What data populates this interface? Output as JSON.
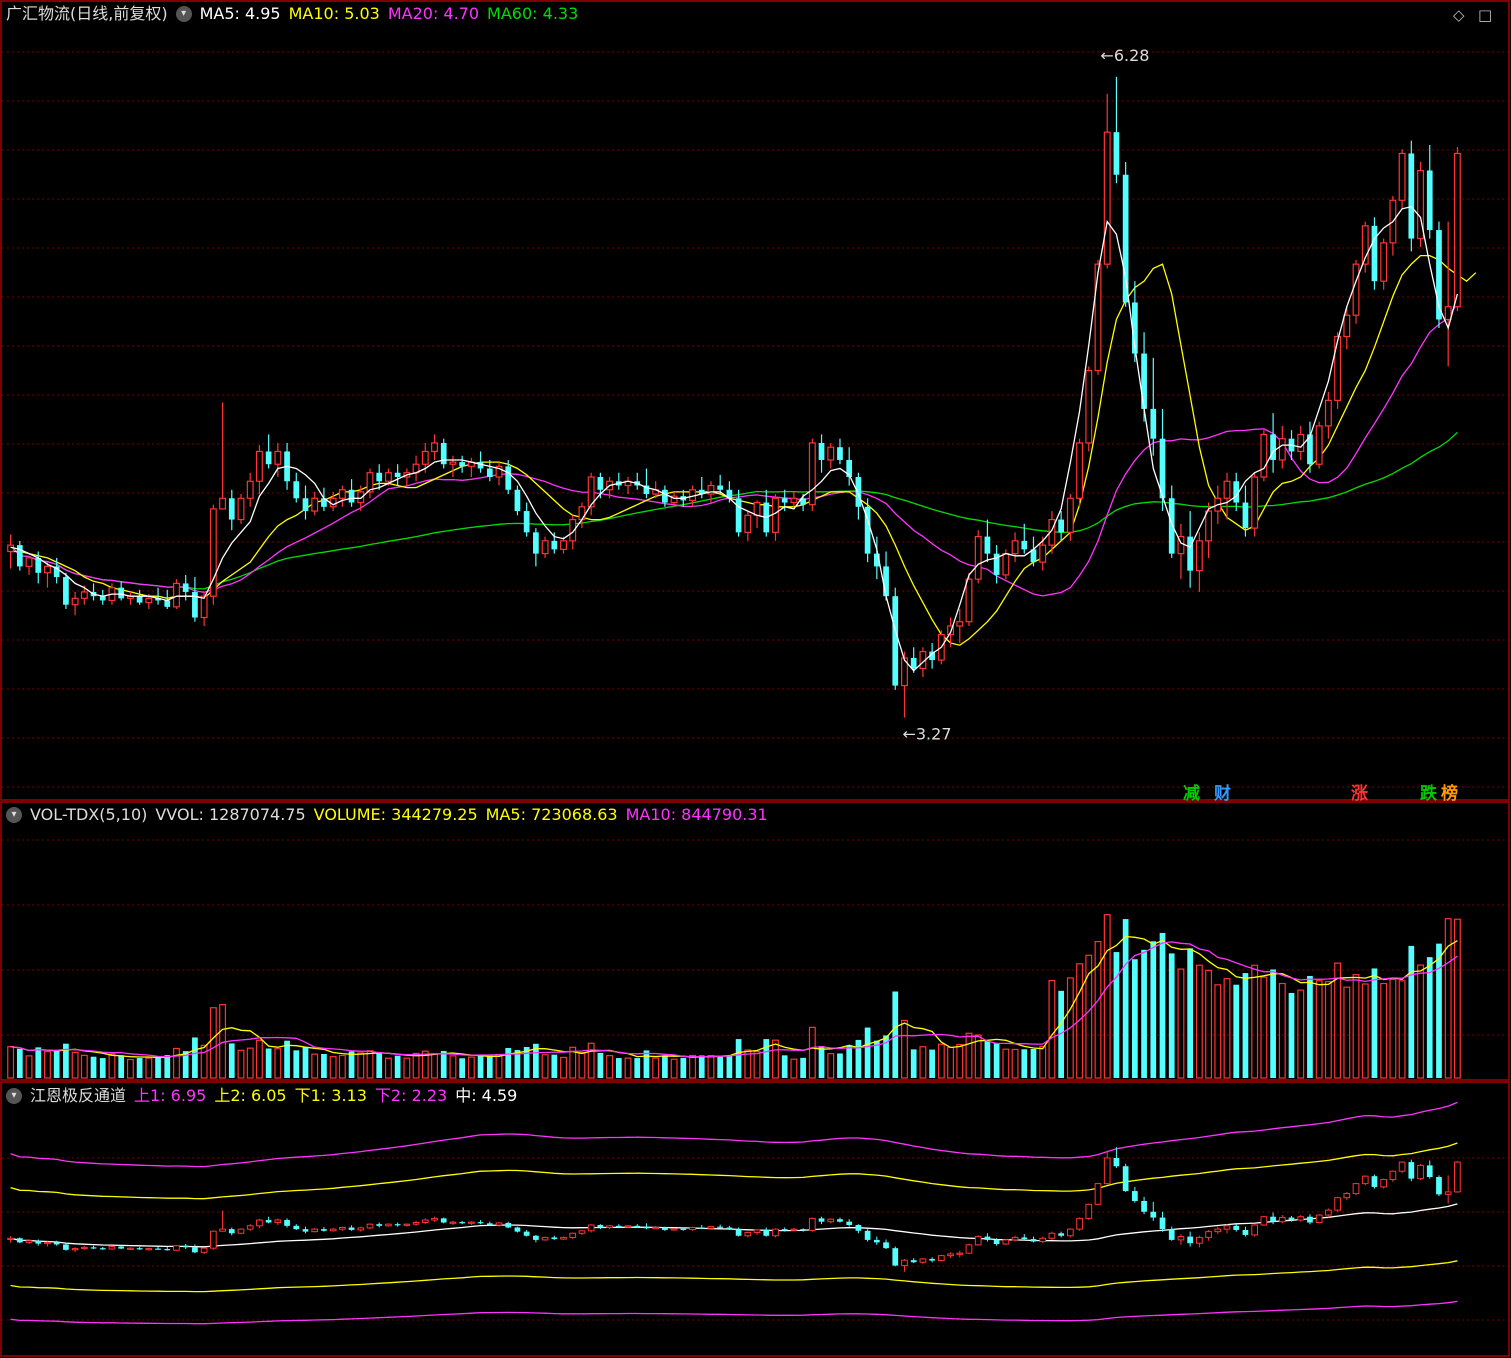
{
  "main": {
    "title": "广汇物流(日线,前复权)",
    "ma": [
      {
        "label": "MA5: 4.95",
        "color": "#ffffff"
      },
      {
        "label": "MA10: 5.03",
        "color": "#ffff00"
      },
      {
        "label": "MA20: 4.70",
        "color": "#ff33ff"
      },
      {
        "label": "MA60: 4.33",
        "color": "#00dd00"
      }
    ],
    "high_label": "6.28",
    "low_label": "3.27",
    "tags": [
      {
        "text": "减",
        "color": "#00cc00"
      },
      {
        "text": "财",
        "color": "#3399ff"
      },
      {
        "text": "涨",
        "color": "#ff3333"
      },
      {
        "text": "跌",
        "color": "#00cc00"
      },
      {
        "text": "榜",
        "color": "#ff9900"
      }
    ]
  },
  "volume": {
    "title": "VOL-TDX(5,10)",
    "vvol": "VVOL: 1287074.75",
    "volume": "VOLUME: 344279.25",
    "ma5": "MA5: 723068.63",
    "ma10": "MA10: 844790.31"
  },
  "channel": {
    "title": "江恩极反通道",
    "up1": "上1: 6.95",
    "up2": "上2: 6.05",
    "dn1": "下1: 3.13",
    "dn2": "下2: 2.23",
    "mid": "中: 4.59"
  },
  "colors": {
    "up": "#ff3333",
    "down": "#54ffff",
    "ma5": "#ffffff",
    "ma10": "#ffff00",
    "ma20": "#ff33ff",
    "ma60": "#00dd00",
    "grid": "#7a0000",
    "border": "#aa0000"
  },
  "chart_data": {
    "type": "candlestick",
    "ylim": [
      3.0,
      6.5
    ],
    "candles": [
      [
        4.05,
        4.13,
        3.97,
        4.08
      ],
      [
        4.08,
        4.1,
        3.96,
        3.98
      ],
      [
        3.98,
        4.03,
        3.94,
        4.02
      ],
      [
        4.02,
        4.05,
        3.9,
        3.95
      ],
      [
        3.95,
        4.0,
        3.88,
        3.98
      ],
      [
        3.98,
        4.02,
        3.9,
        3.93
      ],
      [
        3.93,
        3.95,
        3.78,
        3.8
      ],
      [
        3.8,
        3.86,
        3.75,
        3.83
      ],
      [
        3.83,
        3.89,
        3.8,
        3.86
      ],
      [
        3.86,
        3.9,
        3.82,
        3.84
      ],
      [
        3.84,
        3.87,
        3.8,
        3.82
      ],
      [
        3.82,
        3.9,
        3.8,
        3.88
      ],
      [
        3.88,
        3.91,
        3.82,
        3.83
      ],
      [
        3.83,
        3.86,
        3.8,
        3.84
      ],
      [
        3.84,
        3.87,
        3.8,
        3.81
      ],
      [
        3.81,
        3.85,
        3.78,
        3.83
      ],
      [
        3.83,
        3.88,
        3.8,
        3.82
      ],
      [
        3.82,
        3.87,
        3.78,
        3.79
      ],
      [
        3.79,
        3.92,
        3.78,
        3.9
      ],
      [
        3.9,
        3.94,
        3.82,
        3.86
      ],
      [
        3.86,
        3.93,
        3.72,
        3.74
      ],
      [
        3.74,
        3.86,
        3.7,
        3.84
      ],
      [
        3.84,
        4.27,
        3.8,
        4.25
      ],
      [
        4.25,
        4.75,
        4.25,
        4.3
      ],
      [
        4.3,
        4.34,
        4.15,
        4.2
      ],
      [
        4.2,
        4.32,
        4.18,
        4.3
      ],
      [
        4.3,
        4.42,
        4.26,
        4.38
      ],
      [
        4.38,
        4.55,
        4.32,
        4.52
      ],
      [
        4.52,
        4.6,
        4.44,
        4.46
      ],
      [
        4.46,
        4.56,
        4.4,
        4.52
      ],
      [
        4.52,
        4.56,
        4.34,
        4.38
      ],
      [
        4.38,
        4.42,
        4.28,
        4.3
      ],
      [
        4.3,
        4.36,
        4.2,
        4.24
      ],
      [
        4.24,
        4.33,
        4.22,
        4.3
      ],
      [
        4.3,
        4.35,
        4.24,
        4.26
      ],
      [
        4.26,
        4.33,
        4.24,
        4.3
      ],
      [
        4.3,
        4.36,
        4.26,
        4.34
      ],
      [
        4.34,
        4.39,
        4.26,
        4.28
      ],
      [
        4.28,
        4.36,
        4.24,
        4.33
      ],
      [
        4.33,
        4.44,
        4.3,
        4.42
      ],
      [
        4.42,
        4.46,
        4.34,
        4.38
      ],
      [
        4.38,
        4.44,
        4.36,
        4.42
      ],
      [
        4.42,
        4.46,
        4.36,
        4.4
      ],
      [
        4.4,
        4.44,
        4.36,
        4.42
      ],
      [
        4.42,
        4.5,
        4.38,
        4.46
      ],
      [
        4.46,
        4.56,
        4.42,
        4.52
      ],
      [
        4.52,
        4.6,
        4.48,
        4.56
      ],
      [
        4.56,
        4.58,
        4.44,
        4.46
      ],
      [
        4.46,
        4.5,
        4.4,
        4.47
      ],
      [
        4.47,
        4.5,
        4.42,
        4.45
      ],
      [
        4.45,
        4.49,
        4.4,
        4.47
      ],
      [
        4.47,
        4.52,
        4.42,
        4.44
      ],
      [
        4.44,
        4.48,
        4.38,
        4.4
      ],
      [
        4.4,
        4.47,
        4.36,
        4.45
      ],
      [
        4.45,
        4.48,
        4.32,
        4.34
      ],
      [
        4.34,
        4.36,
        4.22,
        4.24
      ],
      [
        4.24,
        4.28,
        4.12,
        4.14
      ],
      [
        4.14,
        4.16,
        3.98,
        4.04
      ],
      [
        4.04,
        4.12,
        4.02,
        4.1
      ],
      [
        4.1,
        4.14,
        4.04,
        4.06
      ],
      [
        4.06,
        4.12,
        4.04,
        4.1
      ],
      [
        4.1,
        4.22,
        4.06,
        4.2
      ],
      [
        4.2,
        4.28,
        4.16,
        4.26
      ],
      [
        4.26,
        4.42,
        4.22,
        4.4
      ],
      [
        4.4,
        4.42,
        4.3,
        4.34
      ],
      [
        4.34,
        4.4,
        4.3,
        4.38
      ],
      [
        4.38,
        4.42,
        4.34,
        4.36
      ],
      [
        4.36,
        4.4,
        4.32,
        4.38
      ],
      [
        4.38,
        4.42,
        4.34,
        4.36
      ],
      [
        4.36,
        4.44,
        4.3,
        4.32
      ],
      [
        4.32,
        4.38,
        4.3,
        4.34
      ],
      [
        4.34,
        4.36,
        4.26,
        4.28
      ],
      [
        4.28,
        4.33,
        4.26,
        4.31
      ],
      [
        4.31,
        4.34,
        4.26,
        4.29
      ],
      [
        4.29,
        4.36,
        4.26,
        4.34
      ],
      [
        4.34,
        4.4,
        4.3,
        4.32
      ],
      [
        4.32,
        4.38,
        4.28,
        4.36
      ],
      [
        4.36,
        4.41,
        4.32,
        4.34
      ],
      [
        4.34,
        4.38,
        4.28,
        4.3
      ],
      [
        4.3,
        4.34,
        4.12,
        4.14
      ],
      [
        4.14,
        4.24,
        4.1,
        4.22
      ],
      [
        4.22,
        4.29,
        4.16,
        4.28
      ],
      [
        4.28,
        4.34,
        4.12,
        4.14
      ],
      [
        4.14,
        4.32,
        4.1,
        4.3
      ],
      [
        4.3,
        4.34,
        4.24,
        4.28
      ],
      [
        4.28,
        4.33,
        4.26,
        4.3
      ],
      [
        4.3,
        4.32,
        4.24,
        4.27
      ],
      [
        4.27,
        4.58,
        4.24,
        4.56
      ],
      [
        4.56,
        4.6,
        4.42,
        4.48
      ],
      [
        4.48,
        4.56,
        4.44,
        4.54
      ],
      [
        4.54,
        4.58,
        4.46,
        4.48
      ],
      [
        4.48,
        4.54,
        4.36,
        4.4
      ],
      [
        4.4,
        4.42,
        4.2,
        4.26
      ],
      [
        4.26,
        4.3,
        4.0,
        4.04
      ],
      [
        4.04,
        4.12,
        3.92,
        3.98
      ],
      [
        3.98,
        4.05,
        3.82,
        3.84
      ],
      [
        3.84,
        3.88,
        3.4,
        3.42
      ],
      [
        3.42,
        3.58,
        3.27,
        3.55
      ],
      [
        3.55,
        3.6,
        3.48,
        3.5
      ],
      [
        3.5,
        3.6,
        3.46,
        3.58
      ],
      [
        3.58,
        3.62,
        3.5,
        3.54
      ],
      [
        3.54,
        3.68,
        3.52,
        3.66
      ],
      [
        3.66,
        3.74,
        3.6,
        3.7
      ],
      [
        3.7,
        3.78,
        3.62,
        3.72
      ],
      [
        3.72,
        3.95,
        3.7,
        3.92
      ],
      [
        3.92,
        4.15,
        3.9,
        4.12
      ],
      [
        4.12,
        4.2,
        4.0,
        4.04
      ],
      [
        4.04,
        4.08,
        3.9,
        3.94
      ],
      [
        3.94,
        4.06,
        3.92,
        4.04
      ],
      [
        4.04,
        4.14,
        4.0,
        4.1
      ],
      [
        4.1,
        4.18,
        4.04,
        4.06
      ],
      [
        4.06,
        4.12,
        3.98,
        4.0
      ],
      [
        4.0,
        4.12,
        3.96,
        4.08
      ],
      [
        4.08,
        4.24,
        4.04,
        4.2
      ],
      [
        4.2,
        4.24,
        4.1,
        4.14
      ],
      [
        4.14,
        4.32,
        4.1,
        4.3
      ],
      [
        4.3,
        4.58,
        4.26,
        4.56
      ],
      [
        4.56,
        4.92,
        4.52,
        4.9
      ],
      [
        4.9,
        5.42,
        4.88,
        5.4
      ],
      [
        5.4,
        6.2,
        5.38,
        6.02
      ],
      [
        6.02,
        6.28,
        5.78,
        5.82
      ],
      [
        5.82,
        5.88,
        5.2,
        5.22
      ],
      [
        5.22,
        5.32,
        4.94,
        4.98
      ],
      [
        4.98,
        5.08,
        4.66,
        4.72
      ],
      [
        4.72,
        4.96,
        4.5,
        4.58
      ],
      [
        4.58,
        4.72,
        4.24,
        4.3
      ],
      [
        4.3,
        4.36,
        4.02,
        4.04
      ],
      [
        4.04,
        4.18,
        3.92,
        4.12
      ],
      [
        4.12,
        4.24,
        3.88,
        3.96
      ],
      [
        3.96,
        4.14,
        3.86,
        4.1
      ],
      [
        4.1,
        4.28,
        4.02,
        4.24
      ],
      [
        4.24,
        4.36,
        4.18,
        4.3
      ],
      [
        4.3,
        4.42,
        4.2,
        4.38
      ],
      [
        4.38,
        4.42,
        4.24,
        4.28
      ],
      [
        4.28,
        4.36,
        4.12,
        4.16
      ],
      [
        4.16,
        4.42,
        4.12,
        4.4
      ],
      [
        4.4,
        4.62,
        4.38,
        4.6
      ],
      [
        4.6,
        4.7,
        4.42,
        4.48
      ],
      [
        4.48,
        4.64,
        4.44,
        4.58
      ],
      [
        4.58,
        4.62,
        4.48,
        4.52
      ],
      [
        4.52,
        4.64,
        4.48,
        4.6
      ],
      [
        4.6,
        4.66,
        4.42,
        4.46
      ],
      [
        4.46,
        4.66,
        4.44,
        4.64
      ],
      [
        4.64,
        4.8,
        4.58,
        4.76
      ],
      [
        4.76,
        5.08,
        4.72,
        5.06
      ],
      [
        5.06,
        5.2,
        5.0,
        5.16
      ],
      [
        5.16,
        5.42,
        5.12,
        5.4
      ],
      [
        5.4,
        5.6,
        5.36,
        5.58
      ],
      [
        5.58,
        5.62,
        5.28,
        5.32
      ],
      [
        5.32,
        5.52,
        5.28,
        5.5
      ],
      [
        5.5,
        5.72,
        5.44,
        5.7
      ],
      [
        5.7,
        5.94,
        5.66,
        5.92
      ],
      [
        5.92,
        5.98,
        5.46,
        5.52
      ],
      [
        5.52,
        5.88,
        5.48,
        5.84
      ],
      [
        5.84,
        5.96,
        5.52,
        5.56
      ],
      [
        5.56,
        5.6,
        5.1,
        5.14
      ],
      [
        5.14,
        5.6,
        4.92,
        5.2
      ],
      [
        5.2,
        5.95,
        5.18,
        5.92
      ]
    ],
    "ma5": [
      4.07,
      4.06,
      4.04,
      4.02,
      3.99,
      3.97,
      3.94,
      3.9,
      3.88,
      3.85,
      3.84,
      3.85,
      3.85,
      3.84,
      3.84,
      3.84,
      3.83,
      3.82,
      3.84,
      3.84,
      3.84,
      3.83,
      3.92,
      4.02,
      4.09,
      4.14,
      4.19,
      4.31,
      4.37,
      4.44,
      4.45,
      4.44,
      4.41,
      4.37,
      4.3,
      4.27,
      4.29,
      4.3,
      4.3,
      4.34,
      4.35,
      4.37,
      4.39,
      4.41,
      4.42,
      4.44,
      4.47,
      4.48,
      4.48,
      4.48,
      4.47,
      4.46,
      4.45,
      4.44,
      4.42,
      4.38,
      4.31,
      4.23,
      4.17,
      4.12,
      4.11,
      4.14,
      4.2,
      4.27,
      4.32,
      4.36,
      4.37,
      4.38,
      4.37,
      4.35,
      4.34,
      4.32,
      4.3,
      4.3,
      4.31,
      4.32,
      4.33,
      4.33,
      4.3,
      4.26,
      4.24,
      4.22,
      4.21,
      4.23,
      4.26,
      4.25,
      4.31,
      4.34,
      4.38,
      4.43,
      4.44,
      4.41,
      4.32,
      4.2,
      4.06,
      3.84,
      3.68,
      3.54,
      3.49,
      3.53,
      3.57,
      3.6,
      3.67,
      3.8,
      3.94,
      3.99,
      4.01,
      4.02,
      4.04,
      4.03,
      4.03,
      4.06,
      4.1,
      4.15,
      4.25,
      4.47,
      4.71,
      5.02,
      5.36,
      5.6,
      5.54,
      5.34,
      5.01,
      4.72,
      4.44,
      4.31,
      4.18,
      4.09,
      4.07,
      4.16,
      4.25,
      4.27,
      4.28,
      4.31,
      4.38,
      4.42,
      4.44,
      4.52,
      4.55,
      4.55,
      4.54,
      4.59,
      4.72,
      4.85,
      5.04,
      5.2,
      5.32,
      5.43,
      5.52,
      5.57,
      5.6,
      5.66,
      5.67,
      5.62,
      5.4,
      5.2,
      5.1,
      5.26
    ],
    "ma10": [
      4.05,
      4.05,
      4.04,
      4.03,
      4.02,
      4.0,
      3.98,
      3.96,
      3.93,
      3.91,
      3.9,
      3.88,
      3.87,
      3.86,
      3.85,
      3.84,
      3.84,
      3.83,
      3.84,
      3.84,
      3.84,
      3.83,
      3.87,
      3.91,
      3.94,
      3.97,
      4.0,
      4.06,
      4.12,
      4.17,
      4.2,
      4.22,
      4.25,
      4.28,
      4.29,
      4.31,
      4.33,
      4.33,
      4.34,
      4.36,
      4.37,
      4.37,
      4.36,
      4.35,
      4.35,
      4.37,
      4.39,
      4.41,
      4.43,
      4.45,
      4.46,
      4.47,
      4.47,
      4.47,
      4.46,
      4.44,
      4.41,
      4.37,
      4.33,
      4.29,
      4.25,
      4.22,
      4.21,
      4.2,
      4.2,
      4.21,
      4.23,
      4.25,
      4.27,
      4.29,
      4.31,
      4.32,
      4.33,
      4.33,
      4.33,
      4.33,
      4.33,
      4.32,
      4.3,
      4.29,
      4.28,
      4.27,
      4.27,
      4.26,
      4.26,
      4.26,
      4.27,
      4.29,
      4.31,
      4.33,
      4.33,
      4.33,
      4.3,
      4.27,
      4.23,
      4.17,
      4.08,
      3.98,
      3.89,
      3.81,
      3.73,
      3.66,
      3.62,
      3.61,
      3.64,
      3.68,
      3.72,
      3.77,
      3.84,
      3.91,
      3.97,
      4.0,
      4.02,
      4.06,
      4.1,
      4.14,
      4.27,
      4.45,
      4.68,
      4.94,
      5.14,
      5.23,
      5.29,
      5.32,
      5.38,
      5.4,
      5.26,
      5.02,
      4.78,
      4.54,
      4.36,
      4.28,
      4.21,
      4.18,
      4.15,
      4.17,
      4.25,
      4.33,
      4.37,
      4.38,
      4.4,
      4.45,
      4.49,
      4.55,
      4.64,
      4.73,
      4.82,
      4.9,
      5.01,
      5.13,
      5.25,
      5.35,
      5.4,
      5.44,
      5.44,
      5.42,
      5.38,
      5.35,
      5.32,
      5.36
    ]
  }
}
